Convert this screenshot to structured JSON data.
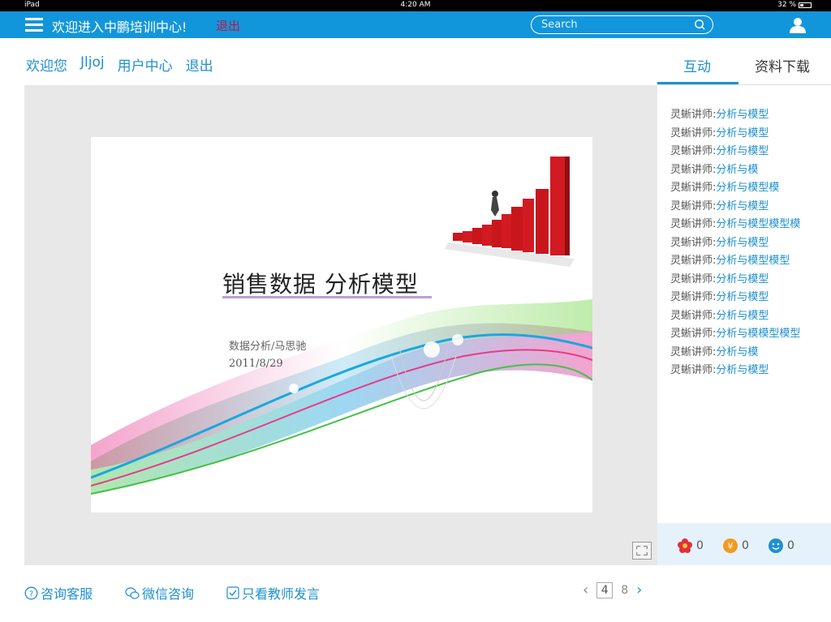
{
  "statusbar": {
    "device": "iPad",
    "time": "4:20 AM",
    "battery": "32 %",
    "battery_level": 0.32
  },
  "header": {
    "welcome_title": "欢迎进入中鹏培训中心!",
    "logout_label": "退出",
    "search_placeholder": "Search"
  },
  "nav": {
    "greeting": "欢迎您",
    "username": "Jljoj",
    "user_center": "用户中心",
    "logout": "退出"
  },
  "tabs": {
    "interact": "互动",
    "downloads": "资料下载"
  },
  "slide": {
    "title": "销售数据  分析模型",
    "subtitle": "数据分析/马思驰",
    "date": "2011/8/29"
  },
  "chat": [
    {
      "speaker": "灵蜥讲师:",
      "text": "分析与模型"
    },
    {
      "speaker": "灵蜥讲师:",
      "text": "分析与模型"
    },
    {
      "speaker": "灵蜥讲师:",
      "text": "分析与模型"
    },
    {
      "speaker": "灵蜥讲师:",
      "text": "分析与模"
    },
    {
      "speaker": "灵蜥讲师:",
      "text": "分析与模型模"
    },
    {
      "speaker": "灵蜥讲师:",
      "text": "分析与模型"
    },
    {
      "speaker": "灵蜥讲师:",
      "text": "分析与模型模型模"
    },
    {
      "speaker": "灵蜥讲师:",
      "text": "分析与模型"
    },
    {
      "speaker": "灵蜥讲师:",
      "text": "分析与模型模型"
    },
    {
      "speaker": "灵蜥讲师:",
      "text": "分析与模型"
    },
    {
      "speaker": "灵蜥讲师:",
      "text": "分析与模型"
    },
    {
      "speaker": "灵蜥讲师:",
      "text": "分析与模型"
    },
    {
      "speaker": "灵蜥讲师:",
      "text": "分析与模模型模型"
    },
    {
      "speaker": "灵蜥讲师:",
      "text": "分析与模"
    },
    {
      "speaker": "灵蜥讲师:",
      "text": "分析与模型"
    }
  ],
  "reactions": {
    "flower": "0",
    "coin": "0",
    "smile": "0"
  },
  "bottom": {
    "consult": "咨询客服",
    "wechat": "微信咨询",
    "teacher_only": "只看教师发言"
  },
  "pager": {
    "current": "4",
    "total": "8"
  },
  "colors": {
    "primary": "#1296db",
    "link": "#1e90d0",
    "logout_red": "#c0174a"
  }
}
